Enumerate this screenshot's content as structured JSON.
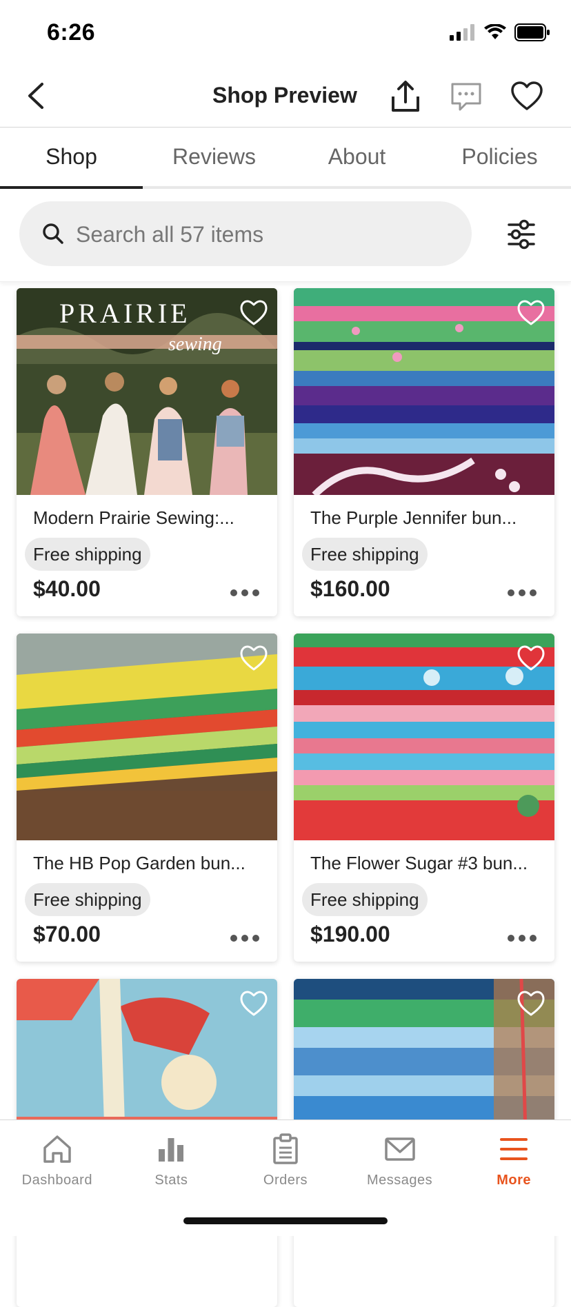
{
  "status_bar": {
    "time": "6:26"
  },
  "nav": {
    "title": "Shop Preview",
    "back_icon": "chevron-left-icon",
    "share_icon": "share-icon",
    "message_icon": "chat-bubble-icon",
    "favorite_icon": "heart-icon"
  },
  "tabs": [
    {
      "label": "Shop",
      "active": true
    },
    {
      "label": "Reviews",
      "active": false
    },
    {
      "label": "About",
      "active": false
    },
    {
      "label": "Policies",
      "active": false
    }
  ],
  "search": {
    "placeholder": "Search all 57 items",
    "value": ""
  },
  "listings": [
    {
      "title": "Modern Prairie Sewing:...",
      "shipping": "Free shipping",
      "price": "$40.00",
      "image_overlay_title": "PRAIRIE",
      "image_overlay_subtitle": "sewing"
    },
    {
      "title": "The Purple Jennifer bun...",
      "shipping": "Free shipping",
      "price": "$160.00"
    },
    {
      "title": "The HB Pop Garden bun...",
      "shipping": "Free shipping",
      "price": "$70.00"
    },
    {
      "title": "The Flower Sugar #3 bun...",
      "shipping": "Free shipping",
      "price": "$190.00"
    },
    {
      "title": "",
      "shipping": "",
      "price": ""
    },
    {
      "title": "",
      "shipping": "",
      "price": ""
    }
  ],
  "tab_bar": [
    {
      "label": "Dashboard",
      "icon": "home-icon",
      "active": false
    },
    {
      "label": "Stats",
      "icon": "bar-chart-icon",
      "active": false
    },
    {
      "label": "Orders",
      "icon": "clipboard-icon",
      "active": false
    },
    {
      "label": "Messages",
      "icon": "envelope-icon",
      "active": false
    },
    {
      "label": "More",
      "icon": "menu-icon",
      "active": true
    }
  ],
  "colors": {
    "accent": "#e8541e",
    "text": "#222222",
    "muted": "#666666"
  }
}
